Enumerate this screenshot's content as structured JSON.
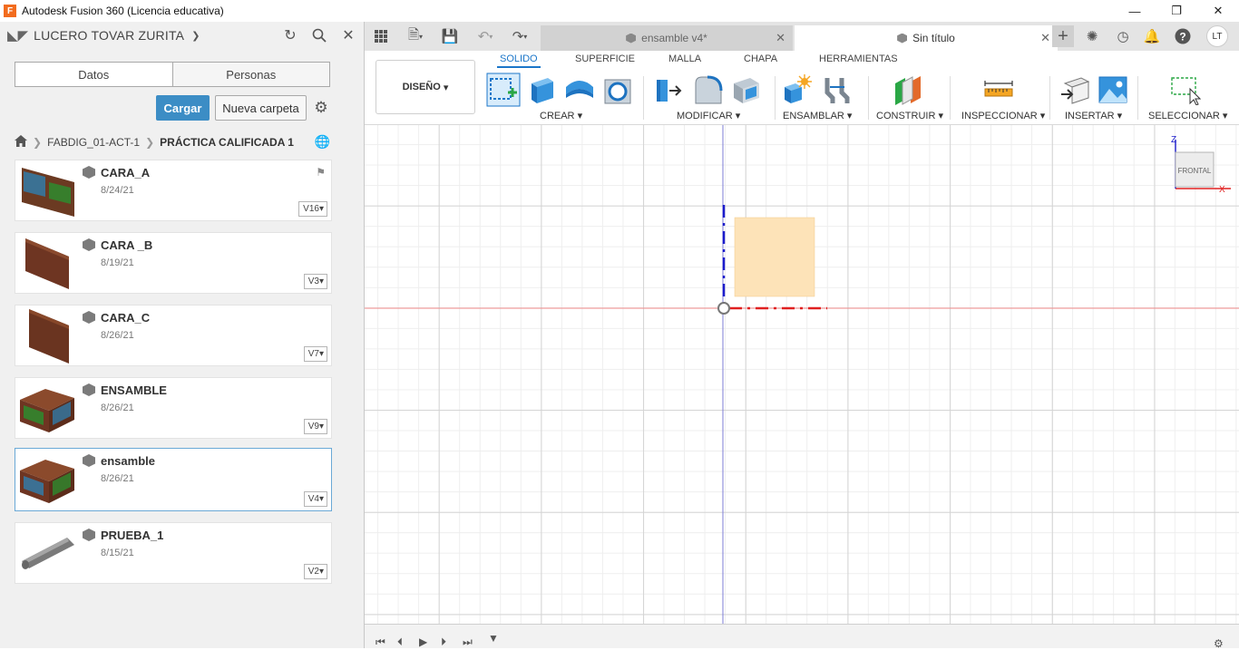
{
  "window": {
    "title": "Autodesk Fusion 360 (Licencia educativa)",
    "logo_letter": "F"
  },
  "data_panel": {
    "user": "LUCERO TOVAR ZURITA",
    "tabs": [
      "Datos",
      "Personas"
    ],
    "upload_label": "Cargar",
    "new_folder_label": "Nueva carpeta",
    "breadcrumb": [
      "FABDIG_01-ACT-1",
      "PRÁCTICA CALIFICADA 1"
    ],
    "files": [
      {
        "name": "CARA_A",
        "date": "8/24/21",
        "version": "V16"
      },
      {
        "name": "CARA _B",
        "date": "8/19/21",
        "version": "V3"
      },
      {
        "name": "CARA_C",
        "date": "8/26/21",
        "version": "V7"
      },
      {
        "name": "ENSAMBLE",
        "date": "8/26/21",
        "version": "V9"
      },
      {
        "name": "ensamble",
        "date": "8/26/21",
        "version": "V4"
      },
      {
        "name": "PRUEBA_1",
        "date": "8/15/21",
        "version": "V2"
      }
    ]
  },
  "tabs": {
    "inactive": "ensamble v4*",
    "active": "Sin título"
  },
  "toolbar": {
    "workspace": "DISEÑO",
    "menu_tabs": [
      "SOLIDO",
      "SUPERFICIE",
      "MALLA",
      "CHAPA",
      "HERRAMIENTAS"
    ],
    "groups": [
      "CREAR",
      "MODIFICAR",
      "ENSAMBLAR",
      "CONSTRUIR",
      "INSPECCIONAR",
      "INSERTAR",
      "SELECCIONAR"
    ]
  },
  "viewcube": {
    "face": "FRONTAL",
    "axis_z": "Z",
    "axis_x": "X"
  },
  "user_initials": "LT",
  "colors": {
    "accent": "#1b76c9",
    "upload_button": "#3c8dc5",
    "sketch_fill": "#fde3b8",
    "axis_x": "#e02020",
    "axis_y": "#1c1ccc"
  }
}
